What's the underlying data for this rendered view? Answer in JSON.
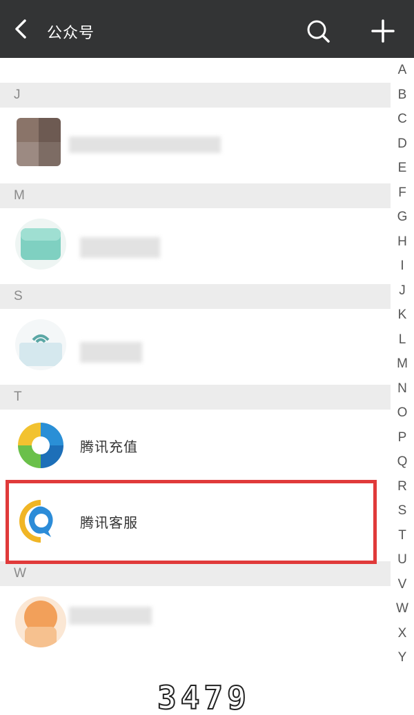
{
  "header": {
    "title": "公众号",
    "back_icon": "back-arrow-icon",
    "search_icon": "search-icon",
    "add_icon": "plus-icon"
  },
  "sections": [
    {
      "letter": "J"
    },
    {
      "letter": "M"
    },
    {
      "letter": "S"
    },
    {
      "letter": "T"
    },
    {
      "letter": "W"
    }
  ],
  "accounts": [
    {
      "name": "腾讯充值"
    },
    {
      "name": "腾讯客服"
    }
  ],
  "index_letters": [
    "A",
    "B",
    "C",
    "D",
    "E",
    "F",
    "G",
    "H",
    "I",
    "J",
    "K",
    "L",
    "M",
    "N",
    "O",
    "P",
    "Q",
    "R",
    "S",
    "T",
    "U",
    "V",
    "W",
    "X",
    "Y"
  ],
  "watermark": "3479",
  "colors": {
    "topbar": "#333435",
    "highlight_border": "#e03a3a",
    "section_bg": "#ececec"
  }
}
